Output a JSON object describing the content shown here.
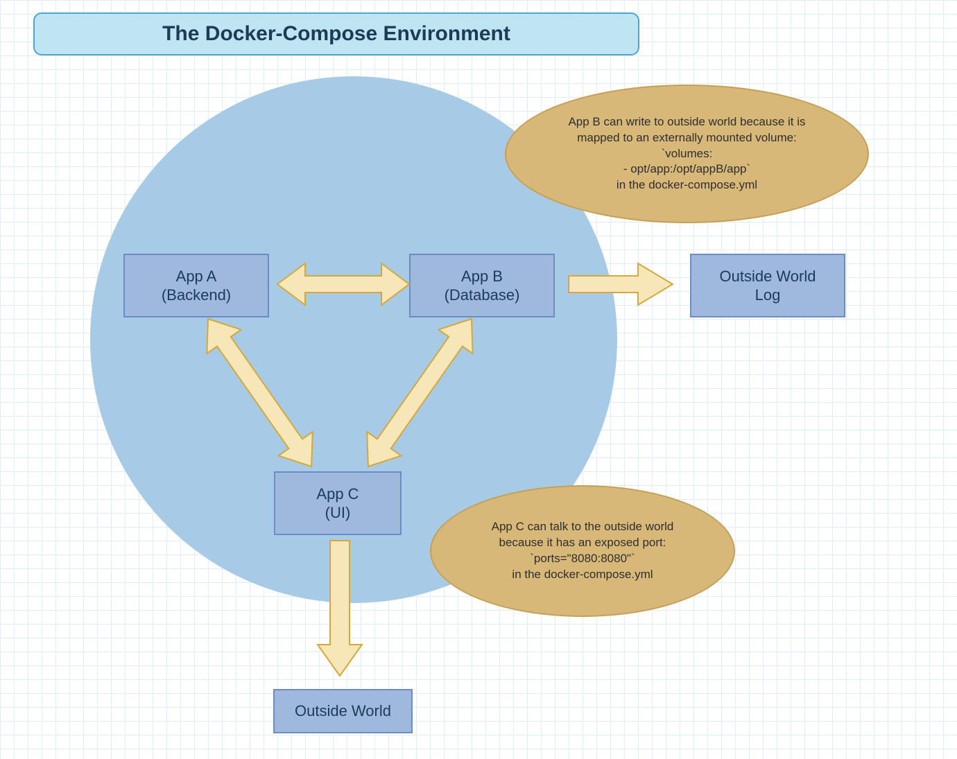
{
  "title": "The Docker-Compose Environment",
  "nodes": {
    "appA": "App A\n(Backend)",
    "appB": "App B\n(Database)",
    "appC": "App C\n(UI)",
    "outsideLog": "Outside World\nLog",
    "outsideWorld": "Outside World"
  },
  "notes": {
    "appB_note": "App B can write to outside world because it is\nmapped to an externally mounted volume:\n`volumes:\n- opt/app:/opt/appB/app`\nin the docker-compose.yml",
    "appC_note": "App C can talk to the outside world\nbecause it has an exposed port:\n`ports=\"8080:8080\"`\nin the docker-compose.yml"
  },
  "colors": {
    "titleFill": "#bfe4f2",
    "titleBorder": "#4aa7cf",
    "circleFill": "#a7cbe6",
    "nodeFill": "#9fb8de",
    "nodeBorder": "#6b8cc4",
    "noteFill": "#d8b878",
    "noteBorder": "#c49f55",
    "arrowFill": "#f7e6b8",
    "arrowStroke": "#d4a83a",
    "textDark": "#1d3a56"
  }
}
